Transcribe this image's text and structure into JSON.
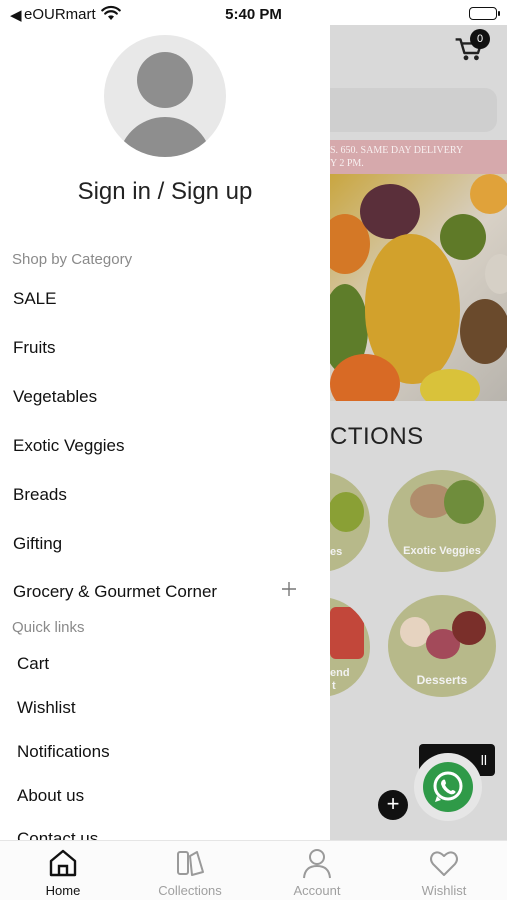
{
  "status_bar": {
    "back_glyph": "◀",
    "carrier": "eOURmart",
    "time": "5:40 PM"
  },
  "drawer": {
    "sign_in_label": "Sign in / Sign up",
    "category_header": "Shop by Category",
    "categories": [
      {
        "label": "SALE"
      },
      {
        "label": "Fruits"
      },
      {
        "label": "Vegetables"
      },
      {
        "label": "Exotic Veggies"
      },
      {
        "label": "Breads"
      },
      {
        "label": "Gifting"
      },
      {
        "label": "Grocery & Gourmet Corner"
      }
    ],
    "quick_links_header": "Quick links",
    "quick_links": [
      {
        "label": "Cart"
      },
      {
        "label": "Wishlist"
      },
      {
        "label": "Notifications"
      },
      {
        "label": "About us"
      },
      {
        "label": "Contact us"
      }
    ]
  },
  "background_page": {
    "cart_count": "0",
    "promo_line1": "S. 650. SAME DAY DELIVERY",
    "promo_line2": "Y 2 PM.",
    "section_title": "CTIONS",
    "collections": [
      {
        "label": "es"
      },
      {
        "label": "Exotic Veggies"
      },
      {
        "label": "end"
      },
      {
        "label": "t"
      },
      {
        "label": "Desserts"
      }
    ],
    "view_all_label": "ll",
    "plus_glyph": "+"
  },
  "tab_bar": {
    "tabs": [
      {
        "label": "Home"
      },
      {
        "label": "Collections"
      },
      {
        "label": "Account"
      },
      {
        "label": "Wishlist"
      }
    ],
    "active_tab": "Home"
  },
  "colors": {
    "promo_banner": "#d6a9ac",
    "collection_circle": "#b7b98a",
    "whatsapp_green": "#2f9a48"
  }
}
